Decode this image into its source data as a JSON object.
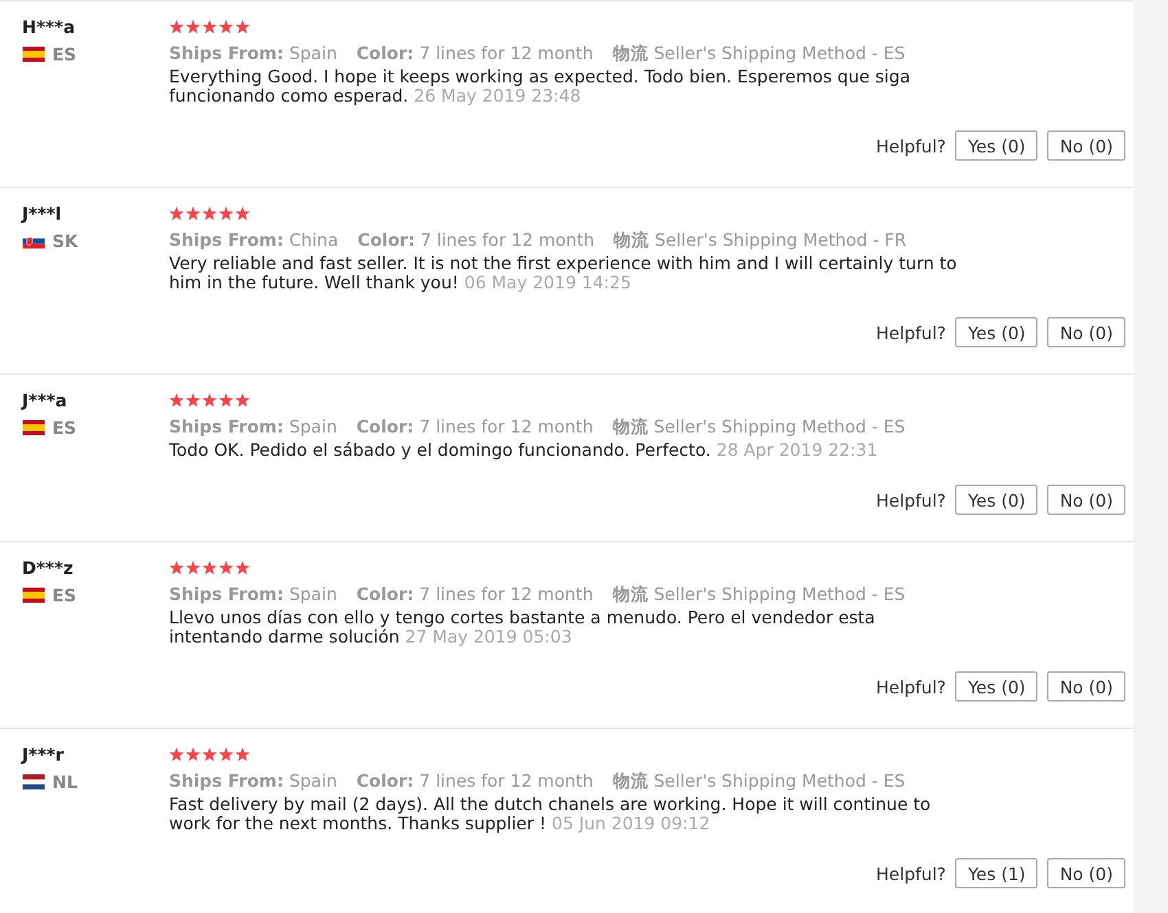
{
  "reviews": [
    {
      "name": "H***a",
      "country": {
        "code": "ES",
        "kind": "es"
      },
      "stars": 5,
      "ships_from_label": "Ships From:",
      "ships_from": "Spain",
      "color_label": "Color:",
      "variant": "7 lines for 12 month",
      "logistics_label": "物流",
      "logistics": "Seller's Shipping Method - ES",
      "text": "Everything Good. I hope it keeps working as expected. Todo bien. Esperemos que siga funcionando como esperad.",
      "date": "26 May 2019 23:48",
      "helpful_label": "Helpful?",
      "yes": "Yes (0)",
      "no": "No (0)"
    },
    {
      "name": "J***l",
      "country": {
        "code": "SK",
        "kind": "sk"
      },
      "stars": 5,
      "ships_from_label": "Ships From:",
      "ships_from": "China",
      "color_label": "Color:",
      "variant": "7 lines for 12 month",
      "logistics_label": "物流",
      "logistics": "Seller's Shipping Method - FR",
      "text": "Very reliable and fast seller. It is not the first experience with him and I will certainly turn to him in the future. Well thank you!",
      "date": "06 May 2019 14:25",
      "helpful_label": "Helpful?",
      "yes": "Yes (0)",
      "no": "No (0)"
    },
    {
      "name": "J***a",
      "country": {
        "code": "ES",
        "kind": "es"
      },
      "stars": 5,
      "ships_from_label": "Ships From:",
      "ships_from": "Spain",
      "color_label": "Color:",
      "variant": "7 lines for 12 month",
      "logistics_label": "物流",
      "logistics": "Seller's Shipping Method - ES",
      "text": "Todo OK. Pedido el sábado y el domingo funcionando. Perfecto.",
      "date": "28 Apr 2019 22:31",
      "helpful_label": "Helpful?",
      "yes": "Yes (0)",
      "no": "No (0)"
    },
    {
      "name": "D***z",
      "country": {
        "code": "ES",
        "kind": "es"
      },
      "stars": 5,
      "ships_from_label": "Ships From:",
      "ships_from": "Spain",
      "color_label": "Color:",
      "variant": "7 lines for 12 month",
      "logistics_label": "物流",
      "logistics": "Seller's Shipping Method - ES",
      "text": "Llevo unos días con ello y tengo cortes bastante a menudo. Pero el vendedor esta intentando darme solución",
      "date": "27 May 2019 05:03",
      "helpful_label": "Helpful?",
      "yes": "Yes (0)",
      "no": "No (0)"
    },
    {
      "name": "J***r",
      "country": {
        "code": "NL",
        "kind": "nl"
      },
      "stars": 5,
      "ships_from_label": "Ships From:",
      "ships_from": "Spain",
      "color_label": "Color:",
      "variant": "7 lines for 12 month",
      "logistics_label": "物流",
      "logistics": "Seller's Shipping Method - ES",
      "text": "Fast delivery by mail (2 days). All the dutch chanels are working. Hope it will continue to work for the next months. Thanks supplier !",
      "date": "05 Jun 2019 09:12",
      "helpful_label": "Helpful?",
      "yes": "Yes (1)",
      "no": "No (0)"
    }
  ]
}
